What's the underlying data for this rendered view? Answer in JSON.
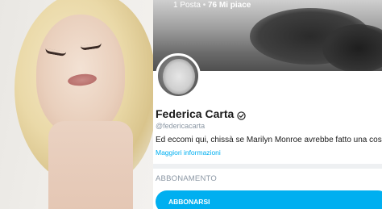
{
  "profile": {
    "posts": "1 Posta",
    "likes": "76 Mi piace",
    "name": "Federica Carta",
    "handle": "@federicacarta",
    "bio": "Ed eccomi qui, chissà se Marilyn Monroe avrebbe fatto una cosa del",
    "more_info": "Maggiori informazioni"
  },
  "subscription": {
    "title": "ABBONAMENTO",
    "subscribe_label": "ABBONARSI"
  },
  "colors": {
    "accent": "#00aff0",
    "muted": "#8a96a3"
  },
  "icons": {
    "verified": "verified-check-icon"
  }
}
